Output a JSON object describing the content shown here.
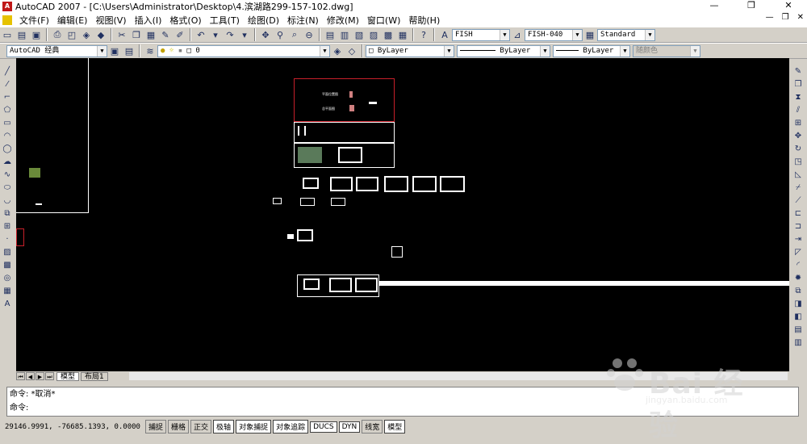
{
  "window": {
    "title": "AutoCAD 2007 - [C:\\Users\\Administrator\\Desktop\\4.滨湖路299-157-102.dwg]",
    "app_icon": "autocad-logo-icon",
    "minimize": "—",
    "restore": "❐",
    "close": "✕"
  },
  "menu": {
    "items": [
      "文件(F)",
      "编辑(E)",
      "视图(V)",
      "插入(I)",
      "格式(O)",
      "工具(T)",
      "绘图(D)",
      "标注(N)",
      "修改(M)",
      "窗口(W)",
      "帮助(H)"
    ],
    "doc_minimize": "—",
    "doc_restore": "❐",
    "doc_close": "✕"
  },
  "styles_toolbar": {
    "text_style": "FISH",
    "dim_style": "FISH-040",
    "table_style": "Standard"
  },
  "workspace": {
    "name": "AutoCAD 经典",
    "layer": "0",
    "color": "ByLayer",
    "linetype": "ByLayer",
    "lineweight": "ByLayer",
    "plot_style": "随颜色"
  },
  "tabs": {
    "model": "模型",
    "layout": "布局1"
  },
  "command": {
    "history": "命令: *取消*",
    "prompt": "命令:"
  },
  "status": {
    "coordinates": "29146.9991, -76685.1393, 0.0000",
    "toggles": [
      {
        "label": "捕捉",
        "on": false
      },
      {
        "label": "栅格",
        "on": false
      },
      {
        "label": "正交",
        "on": false
      },
      {
        "label": "极轴",
        "on": true
      },
      {
        "label": "对象捕捉",
        "on": true
      },
      {
        "label": "对象追踪",
        "on": true
      },
      {
        "label": "DUCS",
        "on": true
      },
      {
        "label": "DYN",
        "on": true
      },
      {
        "label": "线宽",
        "on": false
      },
      {
        "label": "模型",
        "on": true
      }
    ]
  },
  "drawing_text": {
    "plan_label_1": "平面位置图",
    "plan_label_2": "总平面图"
  },
  "watermark": {
    "brand": "Bai 经验",
    "url": "jingyan.baidu.com"
  },
  "colors": {
    "canvas": "#000000",
    "linework": "#ffffff",
    "red_frame": "#c8202a",
    "chrome": "#d4d0c8"
  }
}
